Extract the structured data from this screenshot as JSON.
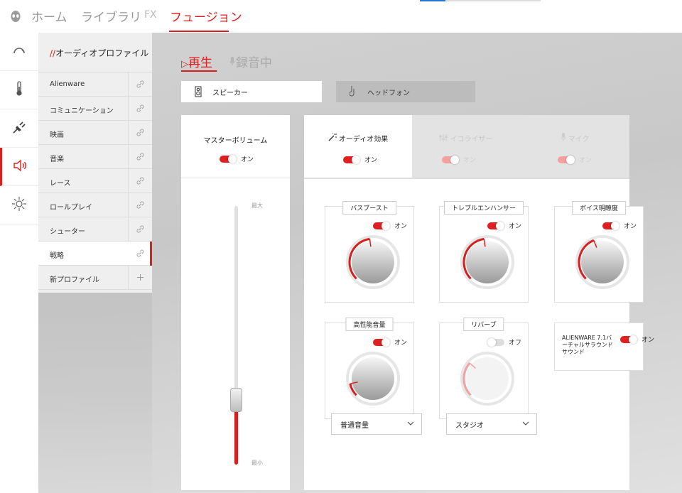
{
  "nav": {
    "items": [
      "ホーム",
      "ライブラリ",
      "FX",
      "フュージョン"
    ],
    "active_index": 3
  },
  "rail": {
    "icons": [
      "performance-gauge-icon",
      "thermal-icon",
      "power-plug-icon",
      "speaker-audio-icon",
      "lighting-sun-icon"
    ],
    "active": "speaker-audio-icon"
  },
  "profiles": {
    "header_slash": "//",
    "header_title": "オーディオプロファイル",
    "items": [
      {
        "label": "Alienware"
      },
      {
        "label": "コミュニケーション"
      },
      {
        "label": "映画"
      },
      {
        "label": "音楽"
      },
      {
        "label": "レース"
      },
      {
        "label": "ロールプレイ"
      },
      {
        "label": "シューター"
      },
      {
        "label": "戦略"
      }
    ],
    "selected": "戦略",
    "new_profile": "新プロファイル",
    "new_profile_icon": "plus-icon"
  },
  "sections": {
    "play": "再生",
    "record": "録音中",
    "active": "play"
  },
  "devices": {
    "speaker": "スピーカー",
    "headphones": "ヘッドフォン",
    "active": "speaker"
  },
  "master": {
    "title": "マスターボリューム",
    "toggle": "オン",
    "max_label": "最大",
    "min_label": "最小",
    "level": 0.2
  },
  "effects": {
    "tabs": [
      {
        "label": "オーディオ効果",
        "toggle": "オン",
        "active": true,
        "icon": "magic-wand-icon"
      },
      {
        "label": "イコライザー",
        "toggle": "オン",
        "active": false,
        "icon": "equalizer-icon"
      },
      {
        "label": "マイク",
        "toggle": "オン",
        "active": false,
        "icon": "microphone-icon"
      }
    ],
    "cards": {
      "bass": {
        "title": "バスブースト",
        "toggle": "オン",
        "level": 0.47
      },
      "treble": {
        "title": "トレブルエンハンサー",
        "toggle": "オン",
        "level": 0.47
      },
      "voice": {
        "title": "ボイス明瞭度",
        "toggle": "オン",
        "level": 0.42
      },
      "loudness": {
        "title": "高性能音量",
        "toggle": "オン",
        "level": 0.12,
        "dropdown": "普通音量"
      },
      "reverb": {
        "title": "リバーブ",
        "toggle": "オフ",
        "level": 0.32,
        "dropdown": "スタジオ"
      },
      "surround": {
        "desc": "ALIENWARE 7.1バーチャルサラウンドサウンド",
        "toggle": "オン"
      }
    }
  },
  "colors": {
    "accent": "#d91e1e",
    "accent_faded": "#f4a0a0",
    "panel_bg": "#ffffff",
    "list_bg": "#efefef"
  }
}
